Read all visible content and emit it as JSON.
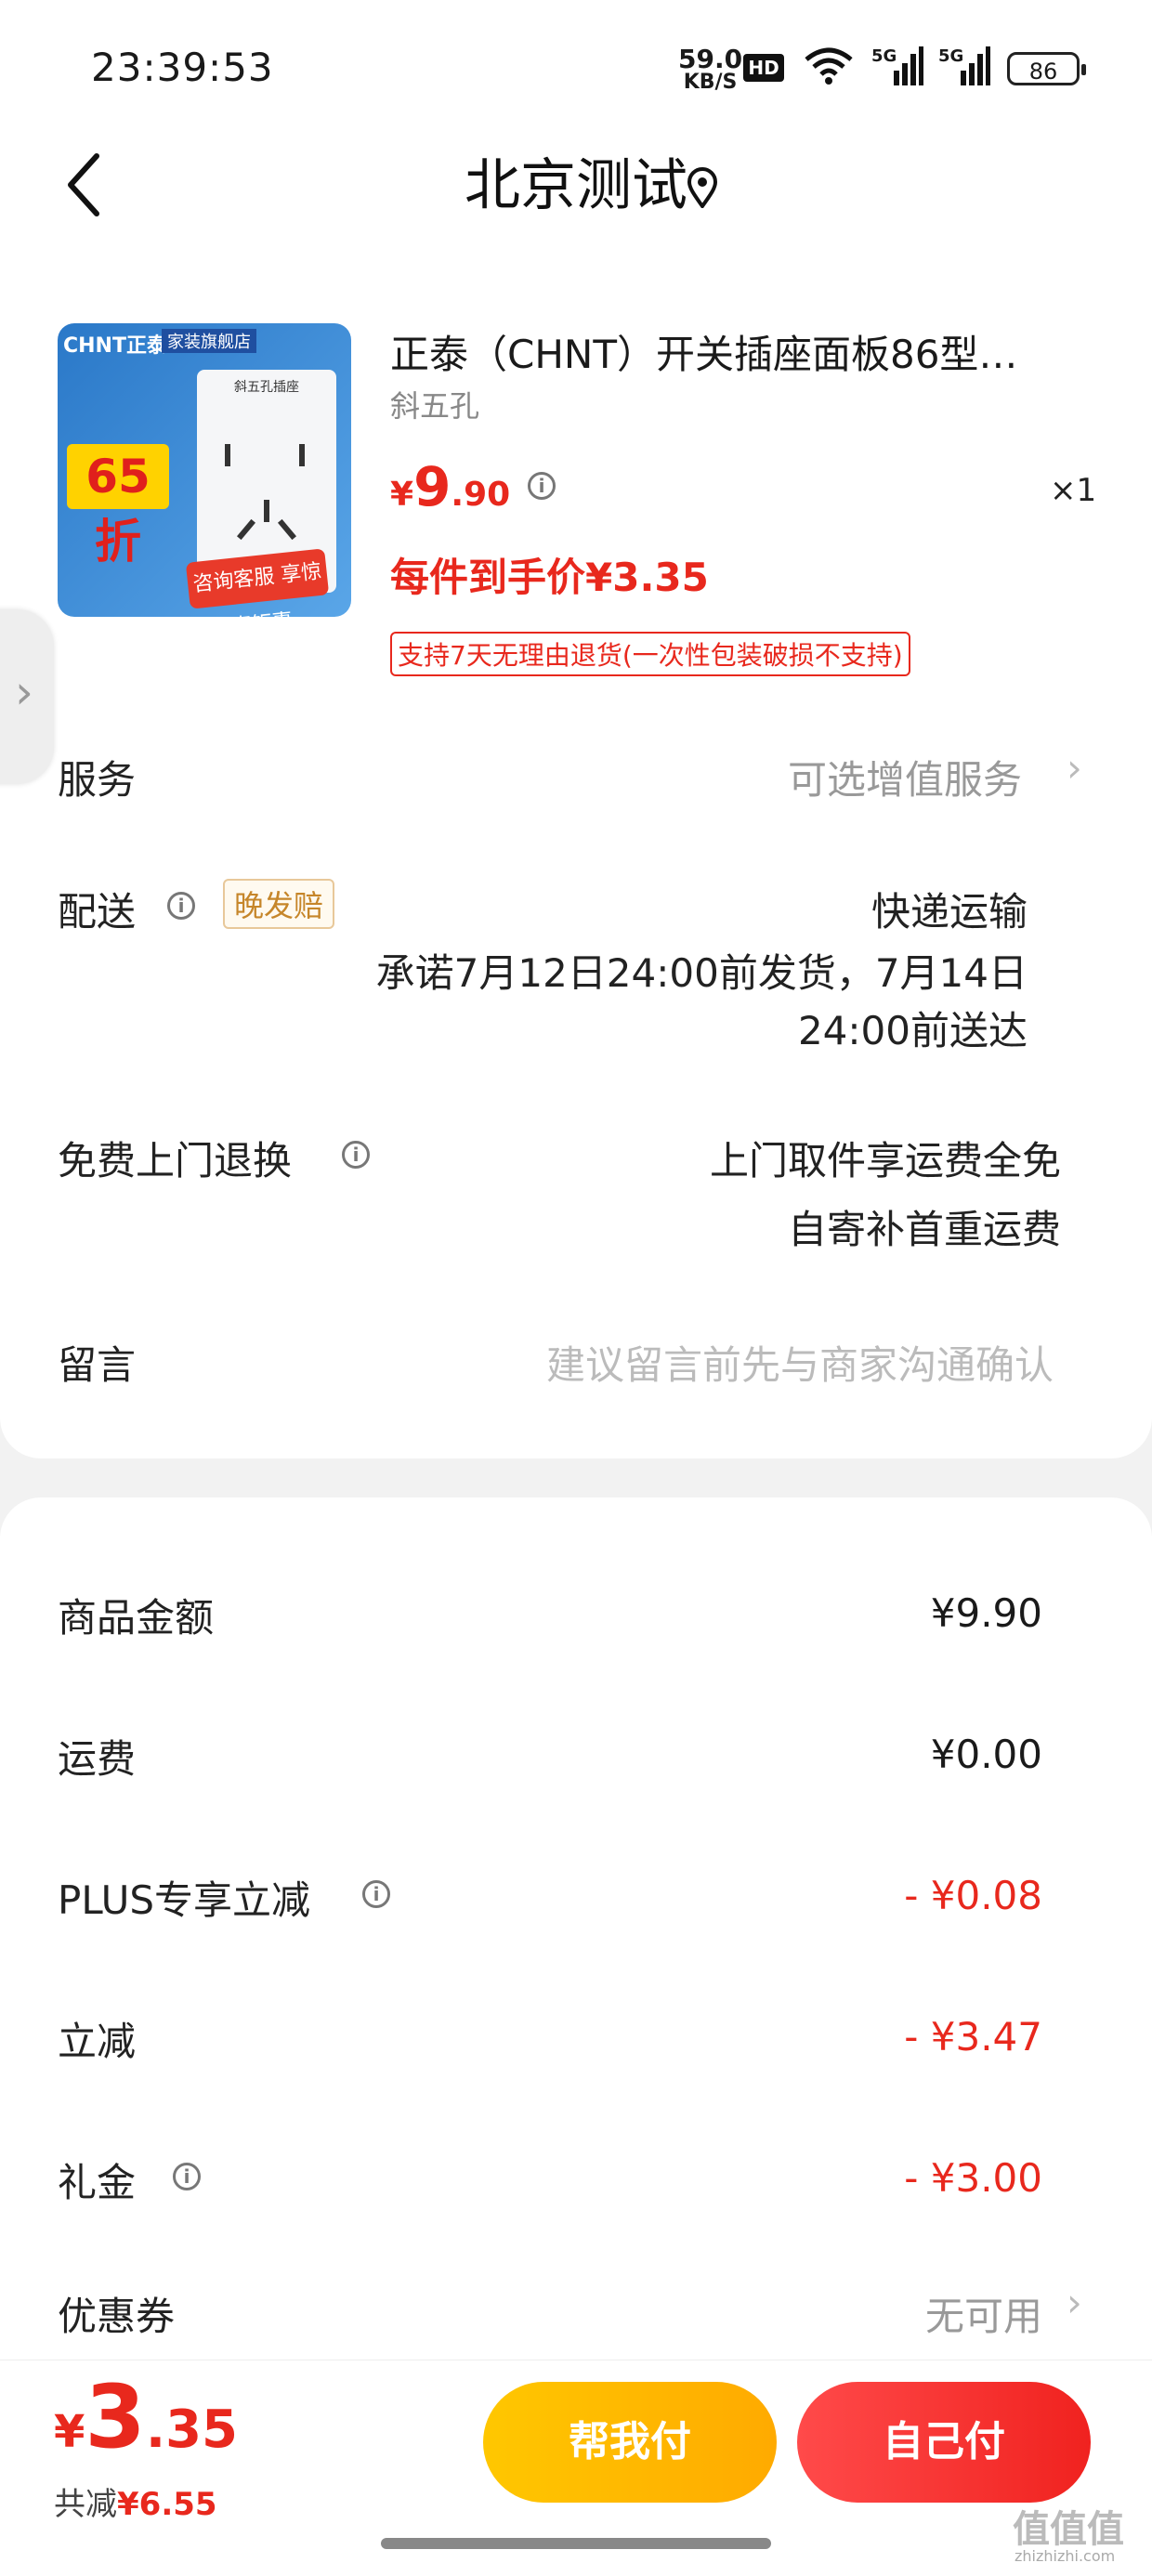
{
  "status_bar": {
    "time": "23:39:53",
    "net_speed": "59.0",
    "net_unit": "KB/S",
    "hd": "HD",
    "signal1": "5G",
    "signal2": "5G",
    "battery": "86"
  },
  "header": {
    "title": "北京测试"
  },
  "product": {
    "name": "正泰（CHNT）开关插座面板86型…",
    "spec": "斜五孔",
    "price_currency": "¥",
    "price_int": "9",
    "price_dec": ".90",
    "quantity": "×1",
    "unit_price_label": "每件到手价¥3.35",
    "return_policy": "支持7天无理由退货(一次性包装破损不支持)",
    "thumb": {
      "brand": "CHNT正泰",
      "store": "家装旗舰店",
      "caption": "斜五孔插座",
      "discount": "65折",
      "promo": "咨询客服 享惊喜钜惠"
    }
  },
  "service": {
    "label": "服务",
    "value": "可选增值服务"
  },
  "delivery": {
    "label": "配送",
    "tag": "晚发赔",
    "method": "快递运输",
    "promise_line1": "承诺7月12日24:00前发货，7月14日",
    "promise_line2": "24:00前送达"
  },
  "free_return": {
    "label": "免费上门退换",
    "line1": "上门取件享运费全免",
    "line2": "自寄补首重运费"
  },
  "message": {
    "label": "留言",
    "placeholder": "建议留言前先与商家沟通确认"
  },
  "summary": {
    "rows": [
      {
        "label": "商品金额",
        "value": "¥9.90"
      },
      {
        "label": "运费",
        "value": "¥0.00"
      },
      {
        "label": "PLUS专享立减",
        "value": "- ¥0.08"
      },
      {
        "label": "立减",
        "value": "- ¥3.47"
      },
      {
        "label": "礼金",
        "value": "- ¥3.00"
      }
    ],
    "coupon_label": "优惠券",
    "coupon_value": "无可用"
  },
  "bottom": {
    "total_currency": "¥",
    "total_int": "3",
    "total_dec": ".35",
    "saved_label": "共减",
    "saved_value": "¥6.55",
    "help_pay": "帮我付",
    "self_pay": "自己付"
  },
  "watermark": {
    "text": "值值值",
    "sub": "zhizhizhi.com"
  },
  "colors": {
    "accent_red": "#e8281d",
    "help_button": "#ffb800",
    "self_button": "#f0221f",
    "late_tag": "#c6862a"
  }
}
